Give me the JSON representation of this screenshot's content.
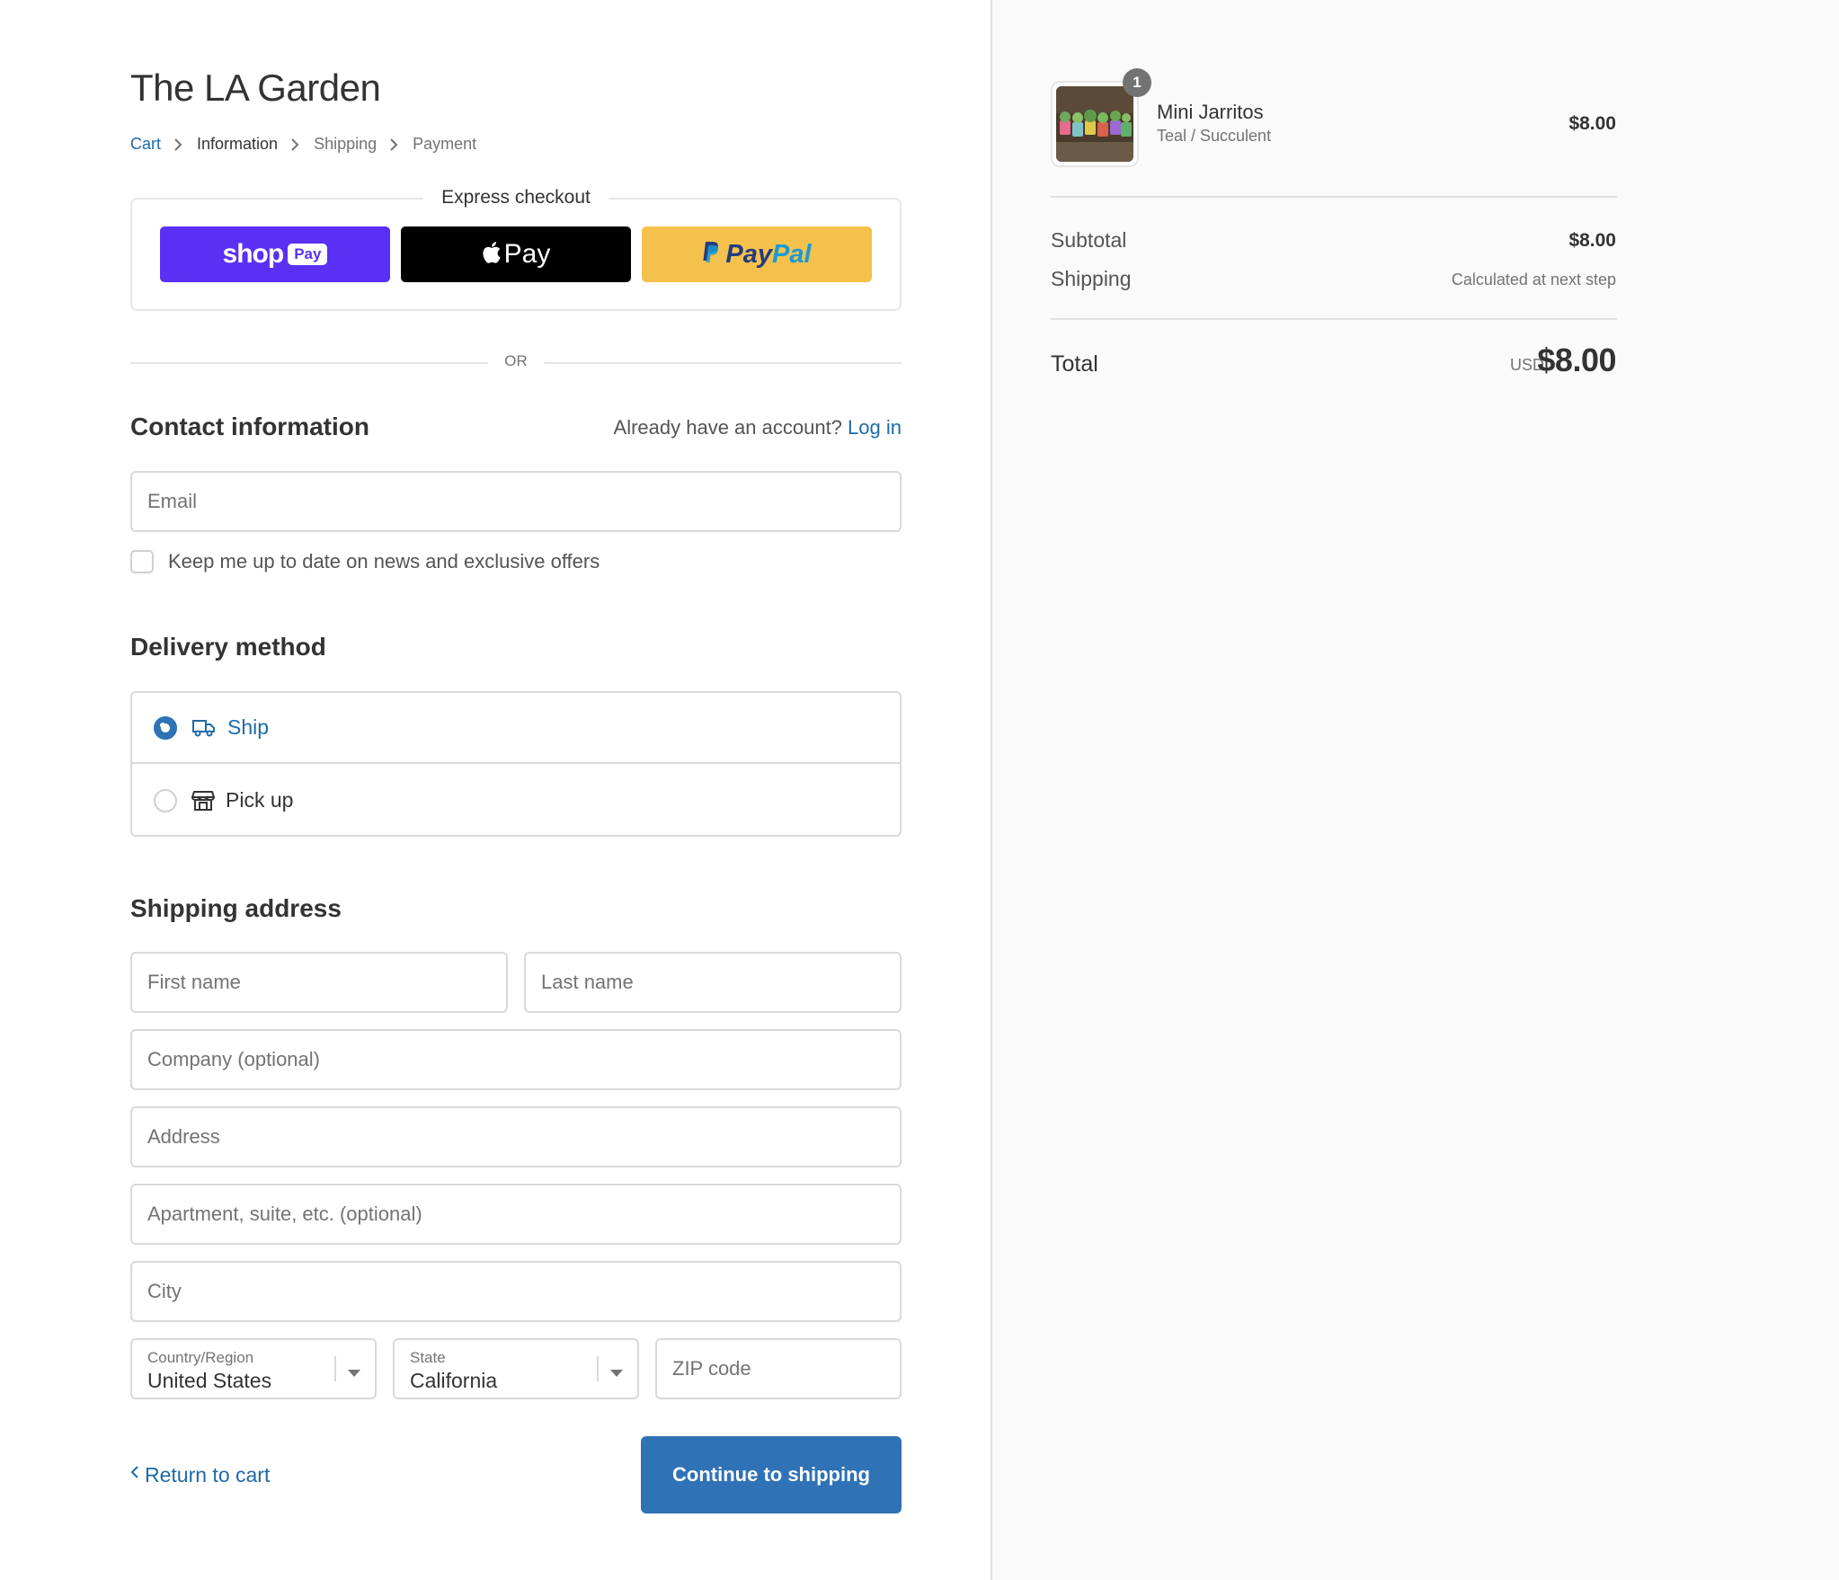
{
  "store": {
    "title": "The LA Garden"
  },
  "breadcrumb": {
    "items": [
      {
        "label": "Cart",
        "state": "link"
      },
      {
        "label": "Information",
        "state": "active"
      },
      {
        "label": "Shipping",
        "state": "upcoming"
      },
      {
        "label": "Payment",
        "state": "upcoming"
      }
    ]
  },
  "express_checkout": {
    "title": "Express checkout",
    "shop_pay": {
      "word": "shop",
      "badge": "Pay",
      "color": "#5a31f4"
    },
    "apple_pay": {
      "word": "Pay",
      "color": "#000000"
    },
    "paypal": {
      "word_1": "Pay",
      "word_2": "Pal",
      "color": "#f4c24c"
    }
  },
  "divider_or": "OR",
  "contact": {
    "heading": "Contact information",
    "account_prompt": "Already have an account?",
    "login_label": "Log in",
    "email_placeholder": "Email",
    "newsletter_label": "Keep me up to date on news and exclusive offers",
    "newsletter_checked": false
  },
  "delivery": {
    "heading": "Delivery method",
    "options": [
      {
        "label": "Ship",
        "icon": "truck-icon",
        "selected": true
      },
      {
        "label": "Pick up",
        "icon": "store-icon",
        "selected": false
      }
    ]
  },
  "shipping_address": {
    "heading": "Shipping address",
    "first_name_placeholder": "First name",
    "last_name_placeholder": "Last name",
    "company_placeholder": "Company (optional)",
    "address_placeholder": "Address",
    "apartment_placeholder": "Apartment, suite, etc. (optional)",
    "city_placeholder": "City",
    "country": {
      "label": "Country/Region",
      "value": "United States"
    },
    "state": {
      "label": "State",
      "value": "California"
    },
    "zip_placeholder": "ZIP code"
  },
  "actions": {
    "return_label": "Return to cart",
    "continue_label": "Continue to shipping"
  },
  "order_summary": {
    "item": {
      "name": "Mini Jarritos",
      "variant": "Teal / Succulent",
      "price": "$8.00",
      "quantity": "1"
    },
    "subtotal_label": "Subtotal",
    "subtotal_value": "$8.00",
    "shipping_label": "Shipping",
    "shipping_value": "Calculated at next step",
    "total_label": "Total",
    "total_currency": "USD",
    "total_value": "$8.00"
  },
  "colors": {
    "accent": "#2f72b6",
    "link": "#1f6aa8"
  }
}
